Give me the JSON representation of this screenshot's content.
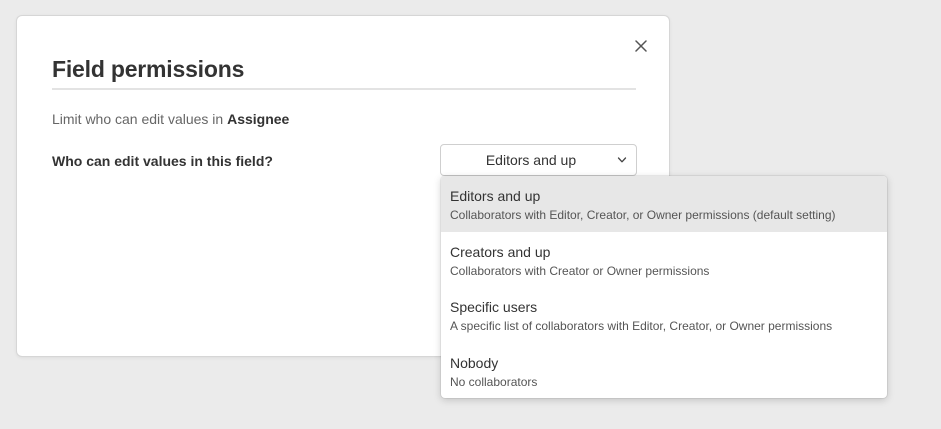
{
  "modal": {
    "title": "Field permissions",
    "description_prefix": "Limit who can edit values in",
    "field_name": "Assignee",
    "question": "Who can edit values in this field?",
    "close_icon": "close-icon"
  },
  "select": {
    "value": "Editors and up",
    "icon": "chevron-down-icon"
  },
  "dropdown": {
    "options": [
      {
        "title": "Editors and up",
        "description": "Collaborators with Editor, Creator, or Owner permissions (default setting)",
        "selected": true
      },
      {
        "title": "Creators and up",
        "description": "Collaborators with Creator or Owner permissions",
        "selected": false
      },
      {
        "title": "Specific users",
        "description": "A specific list of collaborators with Editor, Creator, or Owner permissions",
        "selected": false
      },
      {
        "title": "Nobody",
        "description": "No collaborators",
        "selected": false
      }
    ]
  },
  "colors": {
    "background": "#ebebeb",
    "selected_option": "#e7e7e7",
    "text": "#333333",
    "muted_text": "#666666"
  }
}
